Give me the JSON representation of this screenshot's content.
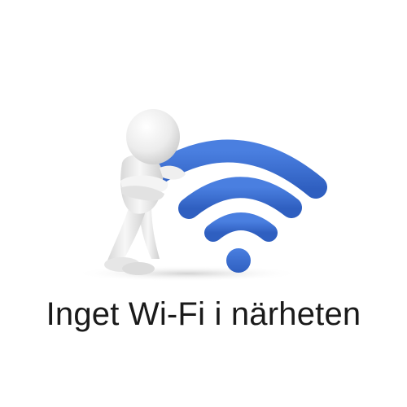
{
  "illustration": {
    "figure_icon": "leaning-3d-person-icon",
    "symbol_icon": "wifi-icon",
    "accent_color": "#3a6fd0",
    "figure_color": "#f2f2f2"
  },
  "caption": {
    "text": "Inget Wi-Fi i närheten"
  }
}
